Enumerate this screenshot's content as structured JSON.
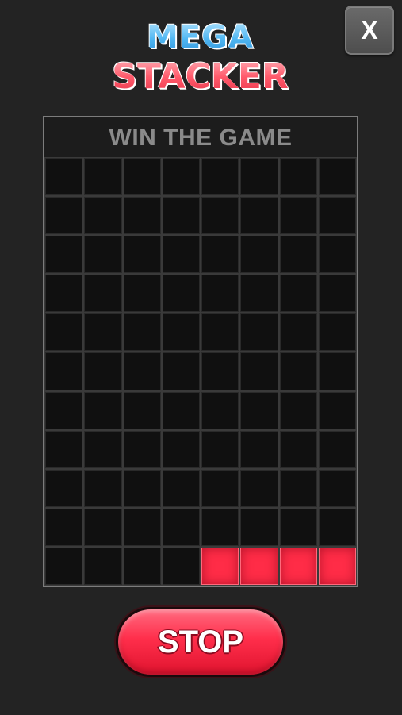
{
  "close_button": {
    "label": "X"
  },
  "logo": {
    "line1": "MEGA",
    "line2": "STACKER"
  },
  "board": {
    "header": "WIN THE GAME",
    "columns": 8,
    "rows": 11,
    "active_row": 11,
    "active_cells": [
      5,
      6,
      7,
      8
    ],
    "active_color": "#ff2c47",
    "empty_color": "#101010"
  },
  "stop_button": {
    "label": "STOP"
  }
}
